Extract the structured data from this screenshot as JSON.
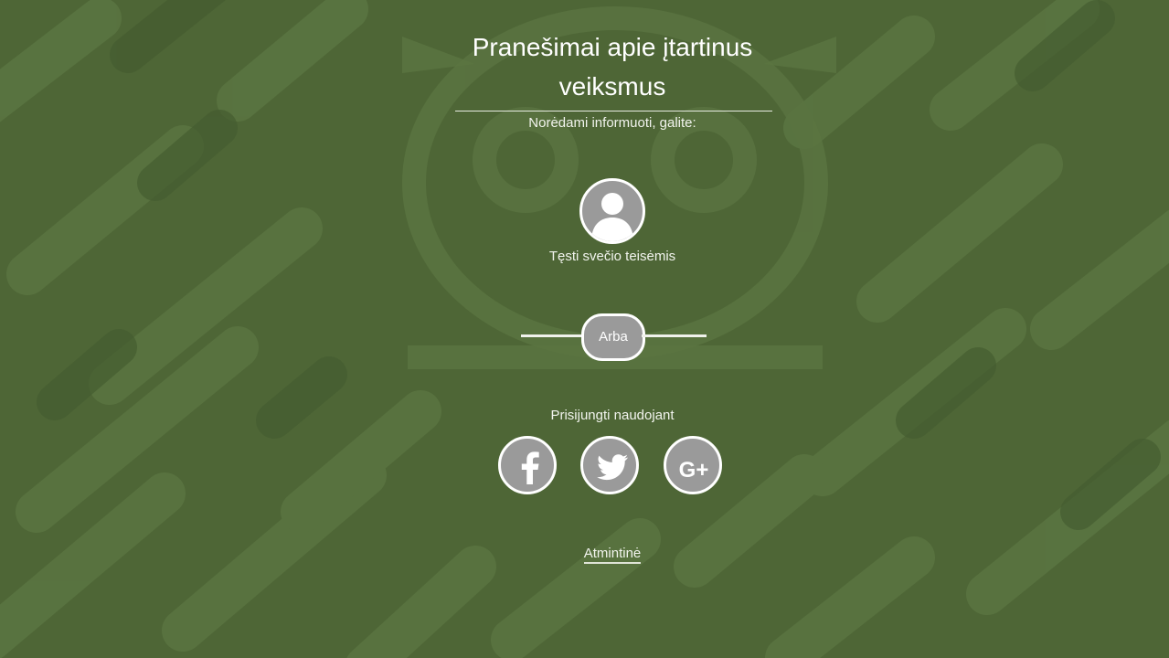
{
  "page": {
    "title": "Pranešimai apie įtartinus veiksmus",
    "subtitle": "Norėdami informuoti, galite:"
  },
  "guest": {
    "icon": "user-avatar-icon",
    "label": "Tęsti svečio teisėmis"
  },
  "divider": {
    "label": "Arba"
  },
  "social_login": {
    "label": "Prisijungti naudojant",
    "providers": [
      {
        "name": "Facebook",
        "icon": "facebook-icon"
      },
      {
        "name": "Twitter",
        "icon": "twitter-icon"
      },
      {
        "name": "Google+",
        "icon": "google-plus-icon"
      }
    ]
  },
  "footer": {
    "memo_link": "Atmintinė"
  },
  "colors": {
    "background": "#4e6636",
    "pattern": "#5a7441",
    "pattern_dark": "#455c30",
    "button_fill": "#9a9a9a",
    "button_border": "#ffffff",
    "text": "#ffffff"
  }
}
